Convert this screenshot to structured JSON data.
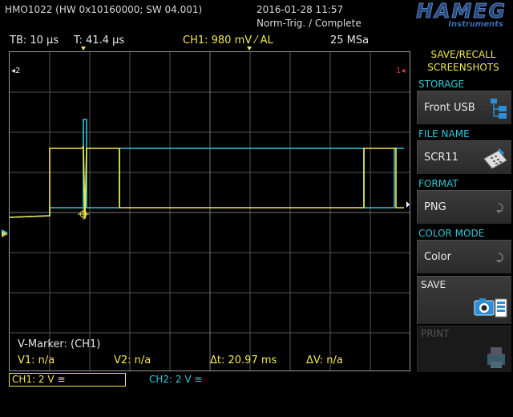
{
  "header": {
    "model": "HMO1022 (HW 0x10160000; SW 04.001)",
    "datetime": "2016-01-28 11:57",
    "trigger_state": "Norm-Trig. / Complete",
    "logo": "HAMEG",
    "logo_sub": "Instruments"
  },
  "status": {
    "timebase": "TB: 10 µs",
    "trigger_time": "T: 41.4 µs",
    "ch1_trigger": "CH1: 980 mV ⁄ AL",
    "sample_rate": "25 MSa"
  },
  "screen": {
    "marker_left": "◂2",
    "marker_right": "1◂",
    "vmarker_title": "V-Marker: (CH1)",
    "v1": "V1: n/a",
    "v2": "V2: n/a",
    "delta_t": "Δt: 20.97 ms",
    "delta_v": "ΔV: n/a"
  },
  "menu": {
    "title_line1": "SAVE/RECALL",
    "title_line2": "SCREENSHOTS",
    "storage_label": "STORAGE",
    "storage_value": "Front USB",
    "storage_icon": "usb-tree-icon",
    "filename_label": "FILE NAME",
    "filename_value": "SCR11",
    "filename_icon": "keyboard-pen-icon",
    "format_label": "FORMAT",
    "format_value": "PNG",
    "colormode_label": "COLOR MODE",
    "colormode_value": "Color",
    "save_label": "SAVE",
    "save_icon": "camera-icon",
    "print_label": "PRINT",
    "print_icon": "printer-icon"
  },
  "channels": {
    "ch1": "CH1: 2 V ≅",
    "ch2": "CH2: 2 V ≅"
  },
  "colors": {
    "ch1": "#f2e84a",
    "ch2": "#2ec8d8",
    "grid": "#5a5a5a",
    "brand": "#24487e"
  }
}
